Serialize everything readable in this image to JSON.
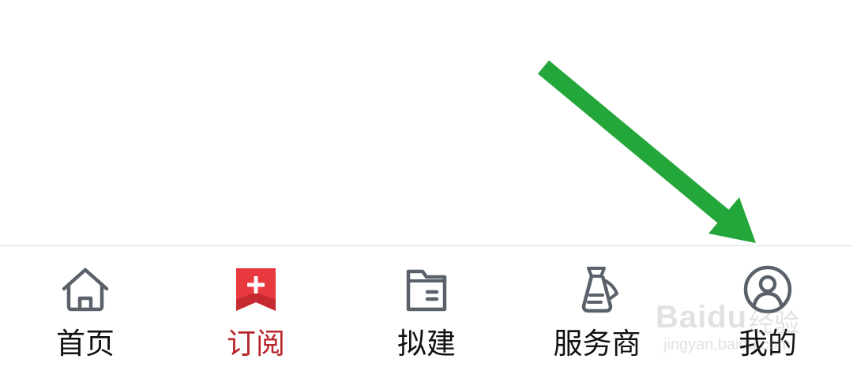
{
  "tabbar": {
    "items": [
      {
        "label": "首页",
        "icon": "home-icon",
        "active": false
      },
      {
        "label": "订阅",
        "icon": "subscribe-icon",
        "active": true
      },
      {
        "label": "拟建",
        "icon": "folder-icon",
        "active": false
      },
      {
        "label": "服务商",
        "icon": "service-provider-icon",
        "active": false
      },
      {
        "label": "我的",
        "icon": "profile-icon",
        "active": false
      }
    ]
  },
  "colors": {
    "active_tab": "#b8262b",
    "subscribe_icon_red": "#e8393f",
    "icon_gray": "#5a616b",
    "arrow_green": "#23a63a",
    "divider": "#dcdcdc"
  },
  "watermark": {
    "brand": "Baidu",
    "suffix": "经验",
    "url": "jingyan.baidu.com"
  }
}
